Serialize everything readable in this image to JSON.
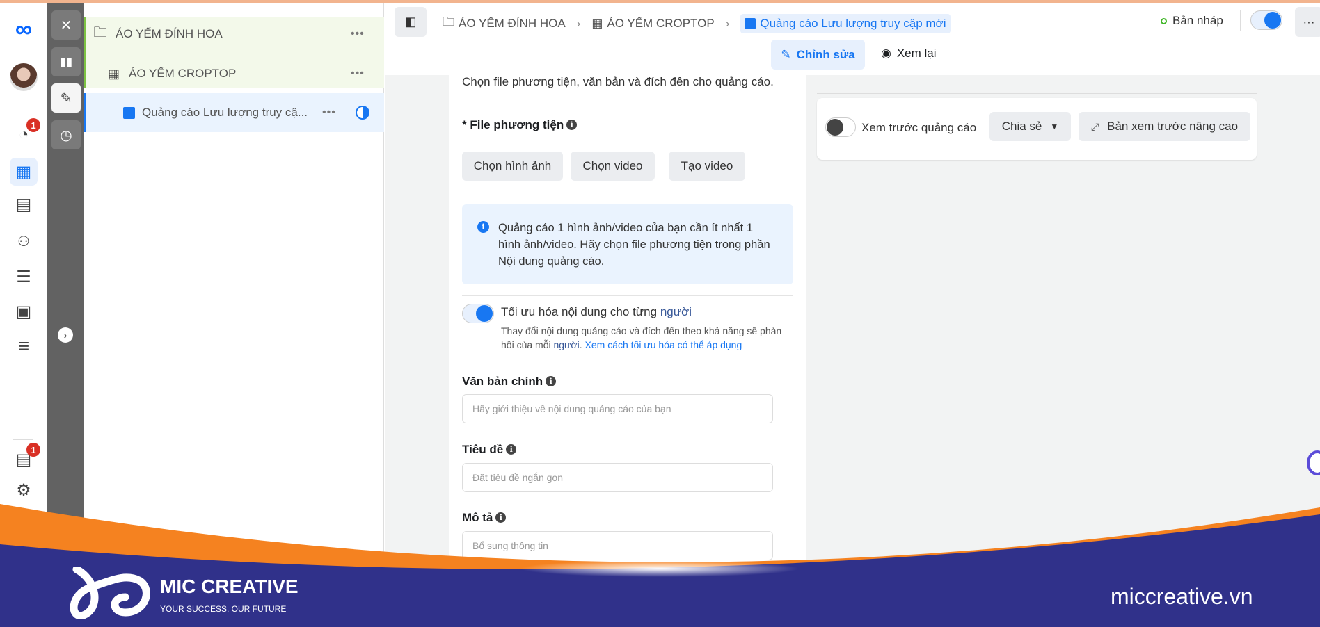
{
  "rail": {
    "items": [
      {
        "icon": "meta-logo-icon"
      },
      {
        "icon": "avatar"
      },
      {
        "icon": "dashboard-icon",
        "badge": "1"
      },
      {
        "icon": "campaigns-table-icon",
        "selected": true
      },
      {
        "icon": "pages-icon"
      },
      {
        "icon": "audiences-icon"
      },
      {
        "icon": "billing-icon"
      },
      {
        "icon": "media-library-icon"
      },
      {
        "icon": "menu-icon"
      },
      {
        "icon": "notifications-icon",
        "badge": "1"
      },
      {
        "icon": "settings-icon"
      }
    ]
  },
  "tree": {
    "items": [
      {
        "label": "ÁO YẾM ĐÍNH HOA",
        "icon": "folder-icon"
      },
      {
        "label": "ÁO YẾM CROPTOP",
        "icon": "grid-icon"
      },
      {
        "label": "Quảng cáo Lưu lượng truy cậ...",
        "icon": "ad-icon"
      }
    ]
  },
  "breadcrumb": {
    "items": [
      "ÁO YẾM ĐÍNH HOA",
      "ÁO YẾM CROPTOP",
      "Quảng cáo Lưu lượng truy cập mới"
    ]
  },
  "header": {
    "status": "Bản nháp",
    "status_color": "#42b72a",
    "toggle_on": true,
    "edit_label": "Chỉnh sửa",
    "review_label": "Xem lại",
    "more": "···"
  },
  "form": {
    "intro": "Chọn file phương tiện, văn bản và đích đên cho quảng cáo.",
    "media_label": "* File phương tiện",
    "buttons": [
      "Chọn hình ảnh",
      "Chọn video",
      "Tạo video"
    ],
    "notice": "Quảng cáo 1 hình ảnh/video của bạn cần ít nhất 1 hình ảnh/video. Hãy chọn file phương tiện trong phần Nội dung quảng cáo.",
    "optimize_title": "Tối ưu hóa nội dung cho từng ",
    "optimize_title_link": "người",
    "optimize_desc": "Thay đổi nội dung quảng cáo và đích đến theo khả năng sẽ phản hồi của mỗi ",
    "optimize_desc_link": "người",
    "optimize_desc_link2": "Xem cách tối ưu hóa có thể áp dụng",
    "optimize_on": true,
    "primary_text_label": "Văn bản chính",
    "primary_text_placeholder": "Hãy giới thiệu về nội dung quảng cáo của bạn",
    "headline_label": "Tiêu đề",
    "headline_placeholder": "Đặt tiêu đề ngắn gọn",
    "description_label": "Mô tả",
    "description_placeholder": "Bổ sung thông tin"
  },
  "preview": {
    "toggle_label": "Xem trước quảng cáo",
    "toggle_on": false,
    "share": "Chia sẻ",
    "advanced": "Bản xem trước nâng cao"
  },
  "footer": {
    "brand": "MIC CREATIVE",
    "tagline": "YOUR SUCCESS, OUR FUTURE",
    "website": "miccreative.vn",
    "navy": "#30318a",
    "orange": "#f58220"
  }
}
